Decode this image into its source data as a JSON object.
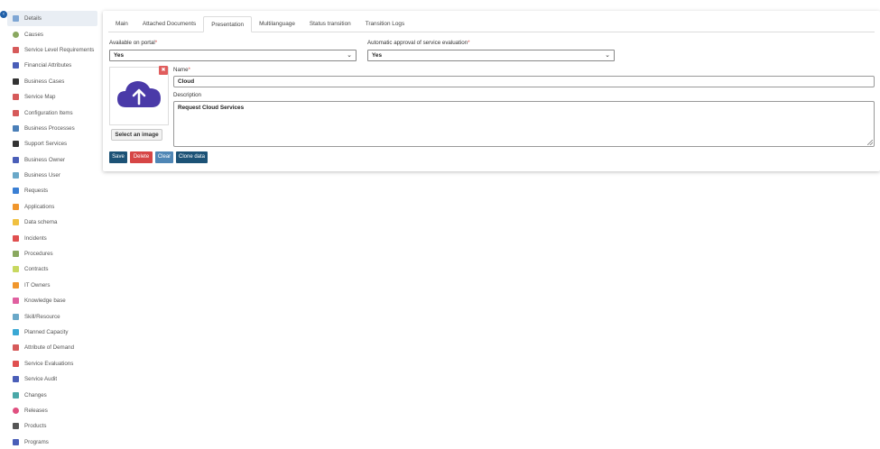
{
  "sidebar": {
    "items": [
      {
        "label": "Details",
        "icon": "filter-icon",
        "color": "#7ea6d4",
        "active": true
      },
      {
        "label": "Causes",
        "icon": "circle-icon",
        "color": "#8aa860"
      },
      {
        "label": "Service Level Requirements",
        "icon": "tools-icon",
        "color": "#d65a5a"
      },
      {
        "label": "Financial Attributes",
        "icon": "dollar-icon",
        "color": "#4a5eb8"
      },
      {
        "label": "Business Cases",
        "icon": "briefcase-icon",
        "color": "#333333"
      },
      {
        "label": "Service Map",
        "icon": "pencil-icon",
        "color": "#d65a5a"
      },
      {
        "label": "Configuration Items",
        "icon": "monitor-icon",
        "color": "#d65a5a"
      },
      {
        "label": "Business Processes",
        "icon": "briefcase-icon",
        "color": "#4a7fb8"
      },
      {
        "label": "Support Services",
        "icon": "wrench-icon",
        "color": "#333333"
      },
      {
        "label": "Business Owner",
        "icon": "gear-icon",
        "color": "#4a5eb8"
      },
      {
        "label": "Business User",
        "icon": "shield-icon",
        "color": "#6aa8c8"
      },
      {
        "label": "Requests",
        "icon": "list-icon",
        "color": "#3a7fd4"
      },
      {
        "label": "Applications",
        "icon": "grid-icon",
        "color": "#f0962c"
      },
      {
        "label": "Data schema",
        "icon": "table-icon",
        "color": "#f0c040"
      },
      {
        "label": "Incidents",
        "icon": "warning-icon",
        "color": "#e05050"
      },
      {
        "label": "Procedures",
        "icon": "book-icon",
        "color": "#8aa860"
      },
      {
        "label": "Contracts",
        "icon": "folder-icon",
        "color": "#c8d860"
      },
      {
        "label": "IT Owners",
        "icon": "users-icon",
        "color": "#f0962c"
      },
      {
        "label": "Knowledge base",
        "icon": "bulb-icon",
        "color": "#e060a0"
      },
      {
        "label": "Skill/Resource",
        "icon": "id-card-icon",
        "color": "#6aa8c8"
      },
      {
        "label": "Planned Capacity",
        "icon": "line-chart-icon",
        "color": "#3aa8d4"
      },
      {
        "label": "Attribute of Demand",
        "icon": "form-icon",
        "color": "#d65a5a"
      },
      {
        "label": "Service Evaluations",
        "icon": "star-icon",
        "color": "#e05050"
      },
      {
        "label": "Service Audit",
        "icon": "eye-icon",
        "color": "#4a5eb8"
      },
      {
        "label": "Changes",
        "icon": "swap-icon",
        "color": "#4aa8a8"
      },
      {
        "label": "Releases",
        "icon": "release-icon",
        "color": "#e05080"
      },
      {
        "label": "Products",
        "icon": "box-icon",
        "color": "#555555"
      },
      {
        "label": "Programs",
        "icon": "apps-icon",
        "color": "#4a5eb8"
      }
    ]
  },
  "tabs": [
    {
      "label": "Main",
      "active": false
    },
    {
      "label": "Attached Documents",
      "active": false
    },
    {
      "label": "Presentation",
      "active": true
    },
    {
      "label": "Multilanguage",
      "active": false
    },
    {
      "label": "Status transition",
      "active": false
    },
    {
      "label": "Transition Logs",
      "active": false
    }
  ],
  "form": {
    "available_on_portal": {
      "label": "Available on portal",
      "required_mark": "*",
      "value": "Yes"
    },
    "automatic_approval": {
      "label": "Automatic approval of service evaluation",
      "required_mark": "*",
      "value": "Yes"
    },
    "name": {
      "label": "Name",
      "required_mark": "*",
      "value": "Cloud"
    },
    "description": {
      "label": "Description",
      "value": "Request Cloud Services"
    },
    "image": {
      "icon": "cloud-upload-icon",
      "color": "#4a3aa8",
      "select_label": "Select an image",
      "delete_label": "✖"
    }
  },
  "actions": {
    "save": "Save",
    "delete": "Delete",
    "clear": "Clear",
    "clone": "Clone data"
  },
  "colors": {
    "primary": "#1c5276",
    "danger": "#d64545",
    "info": "#4f86b5",
    "required": "#d9534f"
  }
}
